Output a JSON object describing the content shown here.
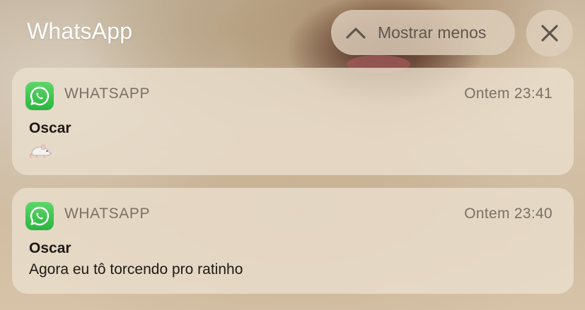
{
  "header": {
    "app_title": "WhatsApp",
    "show_less_label": "Mostrar menos",
    "show_less_icon": "chevron-up-icon",
    "close_icon": "close-icon"
  },
  "notifications": [
    {
      "app_name": "WHATSAPP",
      "app_icon": "whatsapp-icon",
      "time": "Ontem 23:41",
      "sender": "Oscar",
      "message": "🐁"
    },
    {
      "app_name": "WHATSAPP",
      "app_icon": "whatsapp-icon",
      "time": "Ontem 23:40",
      "sender": "Oscar",
      "message": "Agora eu tô torcendo pro ratinho"
    }
  ],
  "colors": {
    "whatsapp_green": "#2ab540",
    "card_bg": "#eadecd",
    "secondary_text": "#7a7166"
  }
}
